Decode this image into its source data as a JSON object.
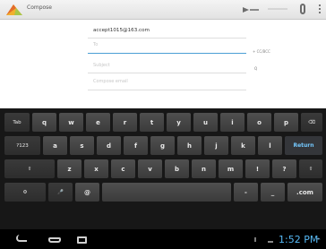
{
  "actionbar": {
    "title": "Compose"
  },
  "compose": {
    "from": "accept1015@163.com",
    "to_placeholder": "To",
    "cc_bcc": "+ CC/BCC",
    "subject_placeholder": "Subject",
    "body_placeholder": "Compose email",
    "attach_label": "Q"
  },
  "keyboard": {
    "row1": [
      "Tab",
      "q",
      "w",
      "e",
      "r",
      "t",
      "y",
      "u",
      "i",
      "o",
      "p",
      "⌫"
    ],
    "row2": [
      "?123",
      "a",
      "s",
      "d",
      "f",
      "g",
      "h",
      "j",
      "k",
      "l",
      "Return"
    ],
    "row3": [
      "⇧",
      "z",
      "x",
      "c",
      "v",
      "b",
      "n",
      "m",
      "!",
      "?",
      "⇧"
    ],
    "row4": [
      "⚙",
      "🎤",
      "@",
      "",
      "-",
      "_",
      ".com"
    ]
  },
  "statusbar": {
    "time": "1:52 PM"
  },
  "colors": {
    "accent": "#4b9fd5",
    "return": "#74c9ff",
    "clock": "#55b8f5"
  }
}
